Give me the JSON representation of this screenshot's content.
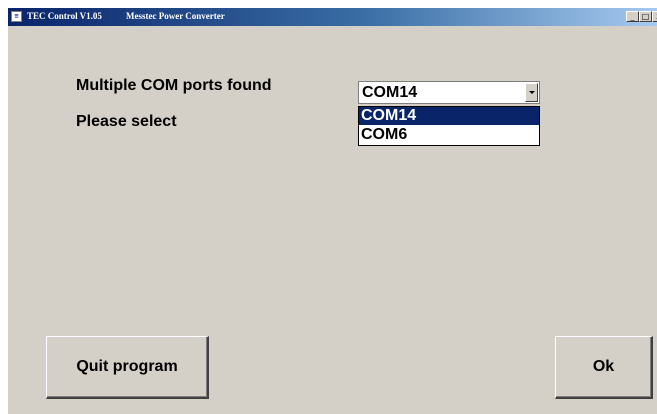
{
  "window": {
    "title": "TEC Control V1.05",
    "subtitle": "Messtec Power Converter",
    "app_icon_glyph": "≡",
    "controls": {
      "minimize": "_",
      "maximize": "□",
      "close": "x"
    }
  },
  "main": {
    "message": "Multiple COM ports found",
    "prompt": "Please select",
    "port_select": {
      "selected": "COM14",
      "options": [
        "COM14",
        "COM6"
      ],
      "highlighted_index": 0
    }
  },
  "buttons": {
    "quit_label": "Quit program",
    "ok_label": "Ok"
  },
  "colors": {
    "window_background": "#d4d0c8",
    "titlebar_active": "#0a246a",
    "selection_highlight": "#0a246a"
  },
  "icons": [
    "app-icon",
    "minimize-icon",
    "maximize-icon",
    "close-icon",
    "dropdown-arrow-icon"
  ]
}
